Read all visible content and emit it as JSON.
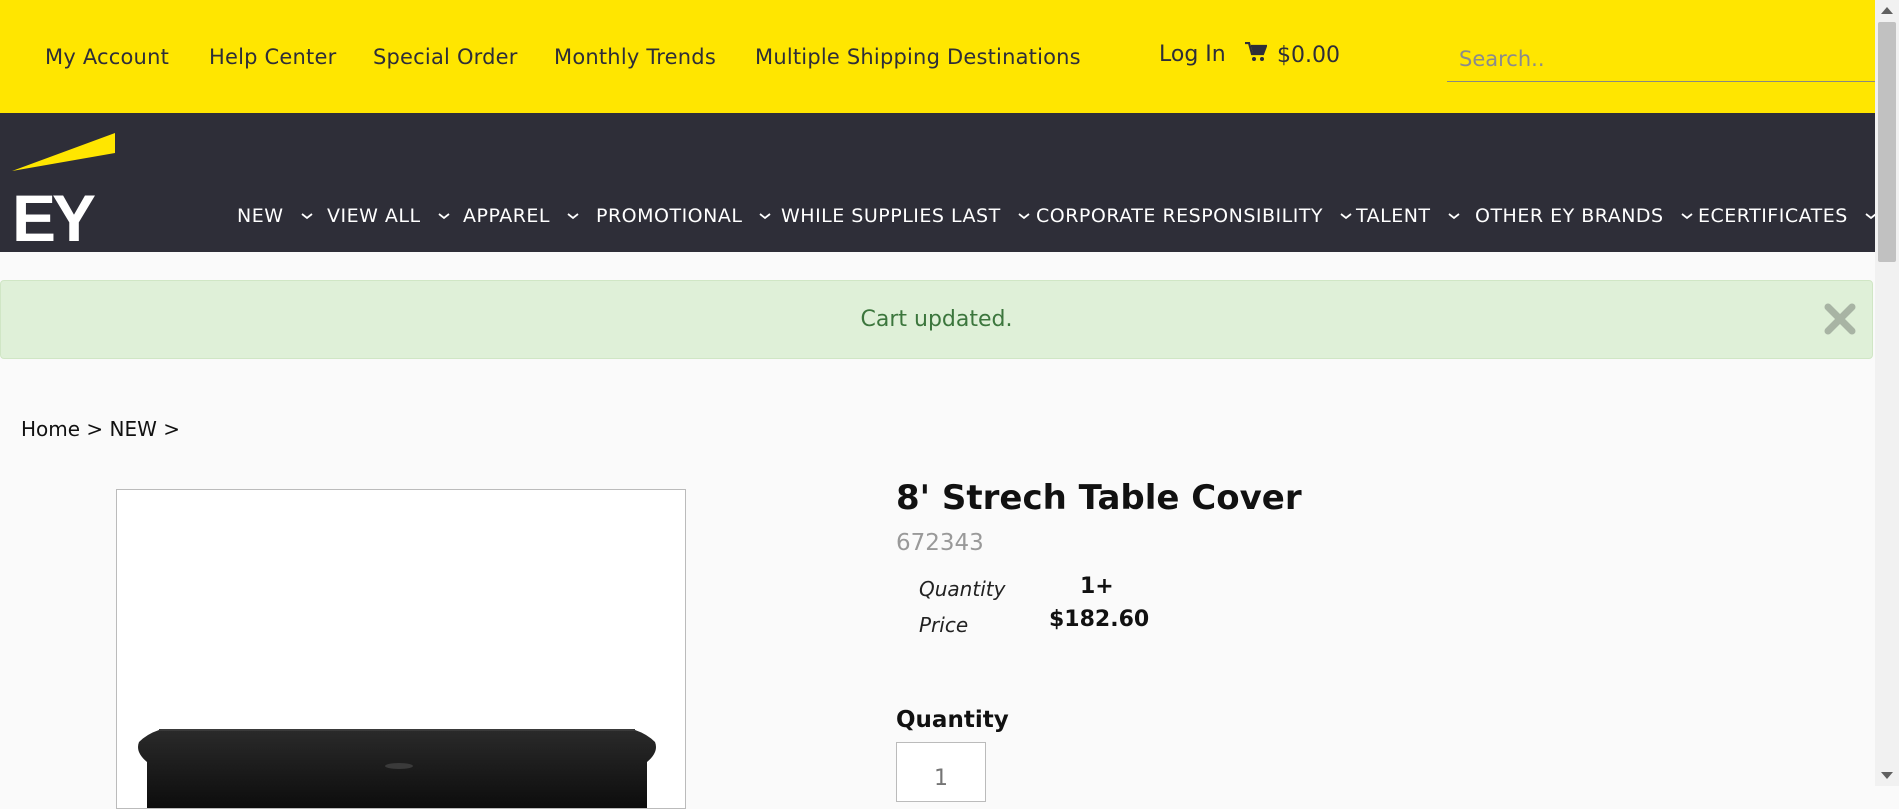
{
  "topbar": {
    "links": [
      "My Account",
      "Help Center",
      "Special Order",
      "Monthly Trends",
      "Multiple Shipping Destinations"
    ],
    "login_label": "Log In",
    "cart_total": "$0.00",
    "search_placeholder": "Search..",
    "background_color": "#ffe600"
  },
  "nav": {
    "background_color": "#2e2e38",
    "items": [
      "NEW",
      "VIEW ALL",
      "APPAREL",
      "PROMOTIONAL",
      "WHILE SUPPLIES LAST",
      "CORPORATE RESPONSIBILITY",
      "TALENT",
      "OTHER EY BRANDS",
      "ECERTIFICATES"
    ],
    "logo_text": "EY"
  },
  "alert": {
    "message": "Cart updated.",
    "background_color": "#dff0d8",
    "text_color": "#3c763d"
  },
  "breadcrumb": {
    "home": "Home",
    "category": "NEW",
    "separator": ">"
  },
  "product": {
    "title": "8' Strech Table Cover",
    "sku": "672343",
    "price_table": {
      "quantity_label": "Quantity",
      "price_label": "Price",
      "quantity_value": "1+",
      "price_value": "$182.60"
    },
    "quantity_label": "Quantity",
    "quantity_placeholder": "1"
  }
}
